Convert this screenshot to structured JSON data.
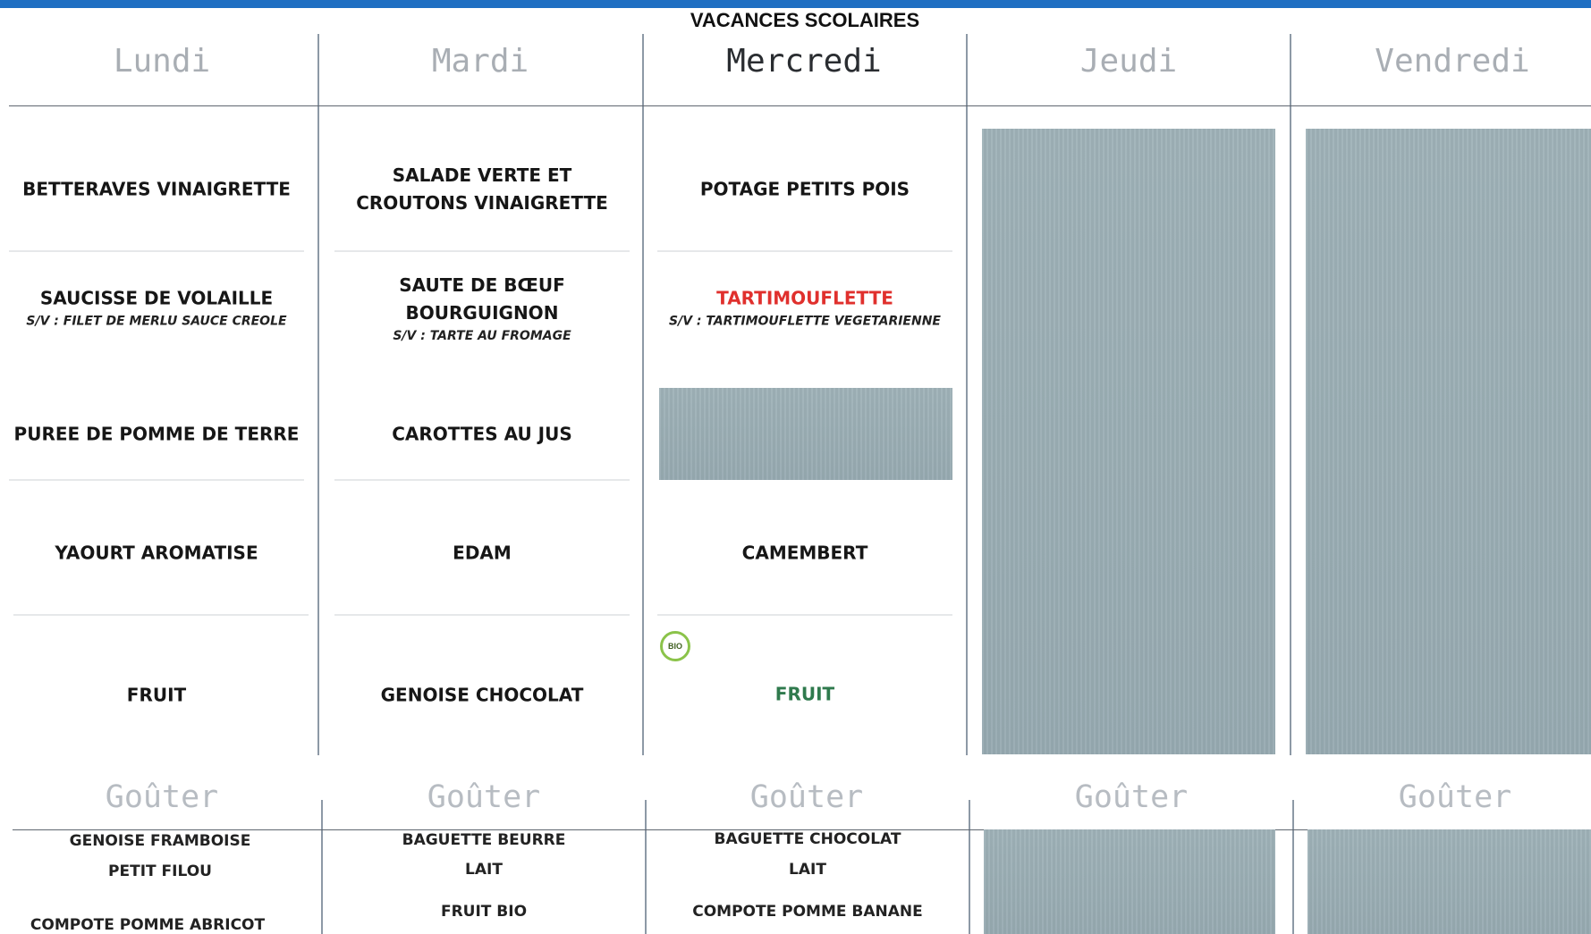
{
  "banner": "VACANCES SCOLAIRES",
  "colors": {
    "top_bar": "#1f6fc2",
    "closed_day": "#9fb2b8",
    "highlight_red": "#e0302d",
    "highlight_green": "#2f7a4d",
    "bio_ring": "#8bc34a"
  },
  "days": {
    "lundi": "Lundi",
    "mardi": "Mardi",
    "mercredi": "Mercredi",
    "jeudi": "Jeudi",
    "vendredi": "Vendredi"
  },
  "gouter_label": "Goûter",
  "lundi": {
    "entree": "BETTERAVES VINAIGRETTE",
    "plat": "SAUCISSE DE VOLAILLE",
    "plat_sv": "S/V : FILET DE MERLU SAUCE CREOLE",
    "accompagnement": "PUREE DE POMME DE TERRE",
    "laitage": "YAOURT AROMATISE",
    "dessert": "FRUIT",
    "gouter": [
      "GENOISE FRAMBOISE",
      "PETIT FILOU",
      "COMPOTE POMME ABRICOT"
    ]
  },
  "mardi": {
    "entree": "SALADE VERTE ET CROUTONS VINAIGRETTE",
    "plat": "SAUTE DE BŒUF BOURGUIGNON",
    "plat_sv": "S/V : TARTE AU FROMAGE",
    "accompagnement": "CAROTTES AU JUS",
    "laitage": "EDAM",
    "dessert": "GENOISE CHOCOLAT",
    "gouter": [
      "BAGUETTE BEURRE",
      "LAIT",
      "FRUIT BIO"
    ]
  },
  "mercredi": {
    "entree": "POTAGE PETITS POIS",
    "plat": "TARTIMOUFLETTE",
    "plat_sv": "S/V : TARTIMOUFLETTE VEGETARIENNE",
    "laitage": "CAMEMBERT",
    "bio_badge": "BIO",
    "dessert": "FRUIT",
    "gouter": [
      "BAGUETTE CHOCOLAT",
      "LAIT",
      "COMPOTE POMME BANANE"
    ]
  }
}
